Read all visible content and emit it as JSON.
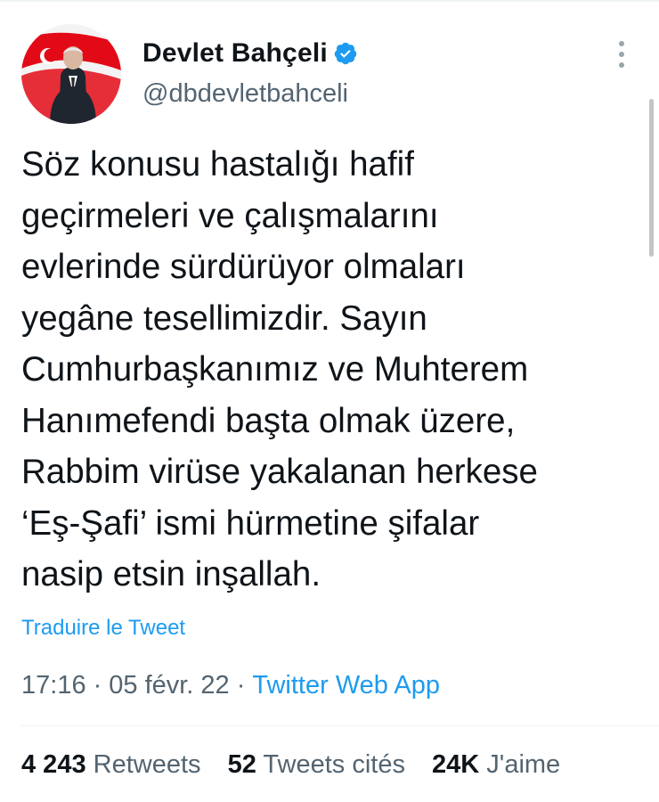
{
  "tweet": {
    "author": {
      "display_name": "Devlet Bahçeli",
      "handle": "@dbdevletbahceli",
      "verified": true,
      "avatar_icon": "profile-avatar-flag"
    },
    "text": "Söz konusu hastalığı hafif\ngeçirmeleri ve çalışmalarını\nevlerinde sürdürüyor olmaları\nyegâne tesellimizdir. Sayın\nCumhurbaşkanımız ve Muhterem\nHanımefendi başta olmak üzere,\nRabbim virüse yakalanan herkese\n‘Eş-Şafi’ ismi hürmetine şifalar\nnasip etsin inşallah.",
    "translate_label": "Traduire le Tweet",
    "time": "17:16",
    "date": "05 févr. 22",
    "separator": "·",
    "source": "Twitter Web App",
    "stats": {
      "retweets_count": "4 243",
      "retweets_label": "Retweets",
      "quotes_count": "52",
      "quotes_label": "Tweets cités",
      "likes_count": "24K",
      "likes_label": "J'aime"
    }
  },
  "icons": {
    "verified": "verified-badge-icon",
    "more": "more-vertical-icon"
  },
  "colors": {
    "accent": "#1d9bf0",
    "text_primary": "#0f1419",
    "text_secondary": "#536471",
    "flag_red": "#e30a17"
  }
}
